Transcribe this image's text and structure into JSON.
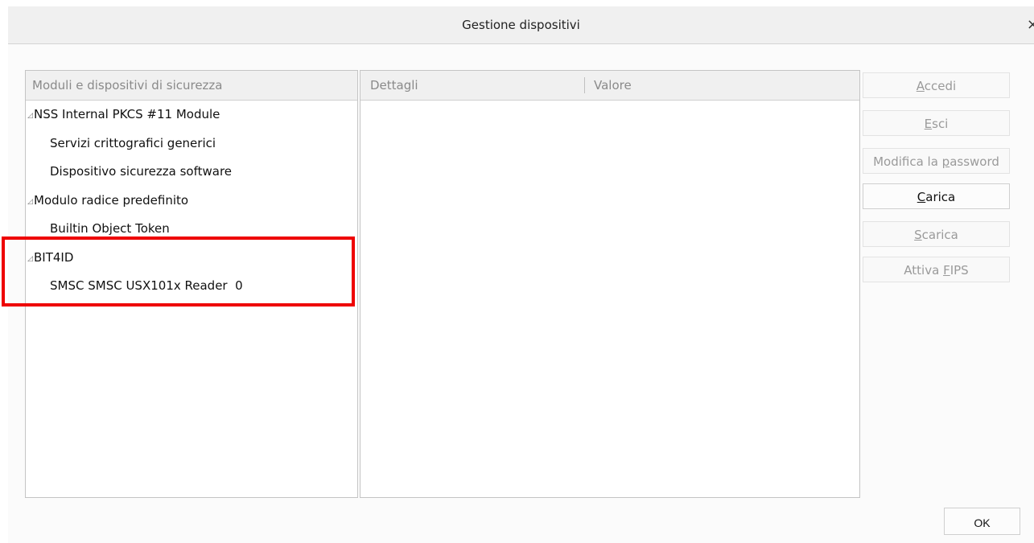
{
  "window": {
    "title": "Gestione dispositivi",
    "close_glyph": "×"
  },
  "tree": {
    "header": "Moduli e dispositivi di sicurezza",
    "twisty": "◿",
    "items": [
      {
        "label": "NSS Internal PKCS #11 Module",
        "level": 0
      },
      {
        "label": "Servizi crittografici generici",
        "level": 1
      },
      {
        "label": "Dispositivo sicurezza software",
        "level": 1
      },
      {
        "label": "Modulo radice predefinito",
        "level": 0
      },
      {
        "label": "Builtin Object Token",
        "level": 1
      },
      {
        "label": "BIT4ID",
        "level": 0
      },
      {
        "label": "SMSC SMSC USX101x Reader  0",
        "level": 1
      }
    ]
  },
  "details": {
    "col_details": "Dettagli",
    "col_value": "Valore"
  },
  "buttons": [
    {
      "pre": "",
      "mnemonic": "A",
      "post": "ccedi",
      "enabled": false
    },
    {
      "pre": "",
      "mnemonic": "E",
      "post": "sci",
      "enabled": false
    },
    {
      "pre": "Modifica la ",
      "mnemonic": "p",
      "post": "assword",
      "enabled": false
    },
    {
      "pre": "",
      "mnemonic": "C",
      "post": "arica",
      "enabled": true
    },
    {
      "pre": "",
      "mnemonic": "S",
      "post": "carica",
      "enabled": false
    },
    {
      "pre": "Attiva ",
      "mnemonic": "F",
      "post": "IPS",
      "enabled": false
    }
  ],
  "ok_button": "OK",
  "colors": {
    "highlight": "#ee0000"
  }
}
